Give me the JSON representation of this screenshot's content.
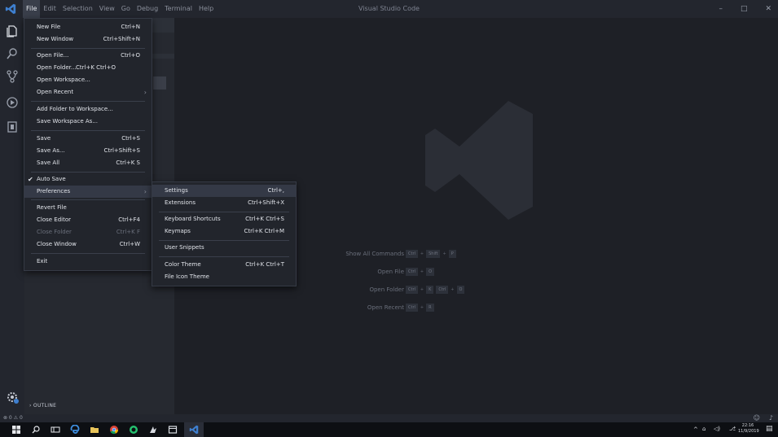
{
  "window": {
    "title": "Visual Studio Code",
    "controls": [
      "–",
      "□",
      "✕"
    ]
  },
  "menubar": [
    {
      "label": "File",
      "active": true
    },
    {
      "label": "Edit"
    },
    {
      "label": "Selection"
    },
    {
      "label": "View"
    },
    {
      "label": "Go"
    },
    {
      "label": "Debug"
    },
    {
      "label": "Terminal"
    },
    {
      "label": "Help"
    }
  ],
  "file_menu": {
    "items": [
      {
        "label": "New File",
        "shortcut": "Ctrl+N"
      },
      {
        "label": "New Window",
        "shortcut": "Ctrl+Shift+N"
      },
      {
        "label": "Open File...",
        "shortcut": "Ctrl+O"
      },
      {
        "label": "Open Folder...",
        "shortcut": "Ctrl+K Ctrl+O"
      },
      {
        "label": "Open Workspace...",
        "shortcut": ""
      },
      {
        "label": "Open Recent",
        "shortcut": ""
      },
      {
        "label": "Add Folder to Workspace...",
        "shortcut": ""
      },
      {
        "label": "Save Workspace As...",
        "shortcut": ""
      },
      {
        "label": "Save",
        "shortcut": "Ctrl+S"
      },
      {
        "label": "Save As...",
        "shortcut": "Ctrl+Shift+S"
      },
      {
        "label": "Save All",
        "shortcut": "Ctrl+K S"
      },
      {
        "label": "Auto Save",
        "shortcut": "",
        "checked": true
      },
      {
        "label": "Preferences",
        "shortcut": ""
      },
      {
        "label": "Revert File",
        "shortcut": ""
      },
      {
        "label": "Close Editor",
        "shortcut": "Ctrl+F4"
      },
      {
        "label": "Close Folder",
        "shortcut": "Ctrl+K F"
      },
      {
        "label": "Close Window",
        "shortcut": "Ctrl+W"
      },
      {
        "label": "Exit",
        "shortcut": ""
      }
    ]
  },
  "preferences_menu": {
    "items": [
      {
        "label": "Settings",
        "shortcut": "Ctrl+,"
      },
      {
        "label": "Extensions",
        "shortcut": "Ctrl+Shift+X"
      },
      {
        "label": "Keyboard Shortcuts",
        "shortcut": "Ctrl+K Ctrl+S"
      },
      {
        "label": "Keymaps",
        "shortcut": "Ctrl+K Ctrl+M"
      },
      {
        "label": "User Snippets",
        "shortcut": ""
      },
      {
        "label": "Color Theme",
        "shortcut": "Ctrl+K Ctrl+T"
      },
      {
        "label": "File Icon Theme",
        "shortcut": ""
      }
    ]
  },
  "welcome": {
    "rows": [
      {
        "label": "Show All Commands",
        "keys": [
          "Ctrl",
          "Shift",
          "P"
        ]
      },
      {
        "label": "Open File",
        "keys": [
          "Ctrl",
          "O"
        ]
      },
      {
        "label": "Open Folder",
        "keys": [
          "Ctrl",
          "K",
          "Ctrl",
          "O"
        ]
      },
      {
        "label": "Open Recent",
        "keys": [
          "Ctrl",
          "R"
        ]
      }
    ]
  },
  "sidebar": {
    "outline_label": "OUTLINE"
  },
  "statusbar": {
    "left": "⊗ 0 ⚠ 0"
  },
  "taskbar": {
    "time": "22:16",
    "date": "11/9/2019"
  },
  "colors": {
    "accent": "#4f8fd6",
    "menu_bg": "#22252c",
    "highlight": "#343946"
  }
}
